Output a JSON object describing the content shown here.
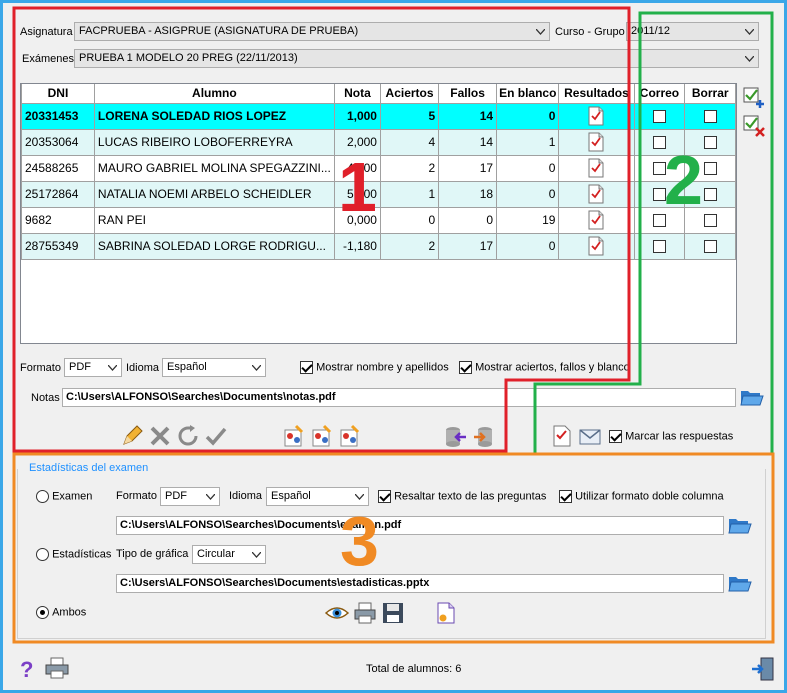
{
  "header": {
    "asignatura_label": "Asignatura",
    "asignatura_value": "FACPRUEBA - ASIGPRUE (ASIGNATURA DE PRUEBA)",
    "curso_label": "Curso - Grupo",
    "curso_value": "2011/12",
    "examenes_label": "Exámenes",
    "examenes_value": "PRUEBA 1 MODELO 20 PREG (22/11/2013)"
  },
  "grid": {
    "columns": [
      "DNI",
      "Alumno",
      "Nota",
      "Aciertos",
      "Fallos",
      "En blanco",
      "Resultados",
      "Correo",
      "Borrar"
    ],
    "rows": [
      {
        "dni": "20331453",
        "alumno": "LORENA SOLEDAD RIOS LOPEZ",
        "nota": "1,000",
        "aciertos": "5",
        "fallos": "14",
        "blanco": "0"
      },
      {
        "dni": "20353064",
        "alumno": "LUCAS RIBEIRO LOBOFERREYRA",
        "nota": "2,000",
        "aciertos": "4",
        "fallos": "14",
        "blanco": "1"
      },
      {
        "dni": "24588265",
        "alumno": "MAURO GABRIEL MOLINA SPEGAZZINI...",
        "nota": "4,000",
        "aciertos": "2",
        "fallos": "17",
        "blanco": "0"
      },
      {
        "dni": "25172864",
        "alumno": "NATALIA NOEMI ARBELO SCHEIDLER",
        "nota": "5,000",
        "aciertos": "1",
        "fallos": "18",
        "blanco": "0"
      },
      {
        "dni": "9682",
        "alumno": "RAN PEI",
        "nota": "0,000",
        "aciertos": "0",
        "fallos": "0",
        "blanco": "19"
      },
      {
        "dni": "28755349",
        "alumno": "SABRINA SOLEDAD LORGE RODRIGU...",
        "nota": "-1,180",
        "aciertos": "2",
        "fallos": "17",
        "blanco": "0"
      }
    ]
  },
  "options": {
    "formato_label": "Formato",
    "formato_value": "PDF",
    "idioma_label": "Idioma",
    "idioma_value": "Español",
    "mostrar_nombre": "Mostrar nombre y apellidos",
    "mostrar_aciertos": "Mostrar aciertos, fallos y blanco",
    "notas_label": "Notas",
    "notas_path": "C:\\Users\\ALFONSO\\Searches\\Documents\\notas.pdf",
    "marcar_respuestas": "Marcar las respuestas"
  },
  "stats": {
    "title": "Estadísticas del examen",
    "examen_label": "Examen",
    "formato_label": "Formato",
    "formato_value": "PDF",
    "idioma_label": "Idioma",
    "idioma_value": "Español",
    "resaltar": "Resaltar texto de las preguntas",
    "doble_columna": "Utilizar formato doble columna",
    "examen_path": "C:\\Users\\ALFONSO\\Searches\\Documents\\examen.pdf",
    "estadisticas_label": "Estadísticas",
    "tipo_grafica_label": "Tipo de gráfica",
    "tipo_grafica_value": "Circular",
    "estadisticas_path": "C:\\Users\\ALFONSO\\Searches\\Documents\\estadisticas.pptx",
    "ambos_label": "Ambos"
  },
  "footer": {
    "total": "Total de alumnos: 6"
  },
  "annotations": {
    "one": "1",
    "two": "2",
    "three": "3",
    "color_red": "#e0202a",
    "color_green": "#22b04a",
    "color_orange": "#f08a24"
  }
}
